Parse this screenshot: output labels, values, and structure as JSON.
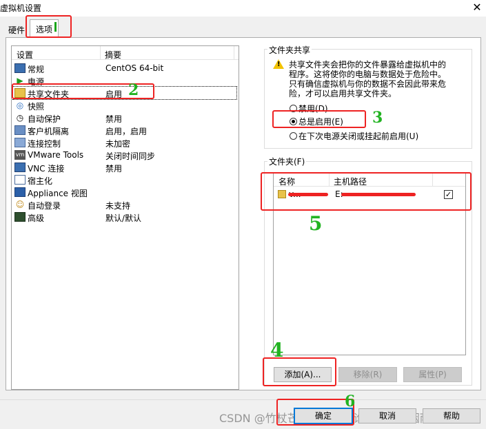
{
  "window": {
    "title": "虚拟机设置",
    "close_glyph": "✕"
  },
  "tabs": [
    {
      "label": "硬件",
      "active": false
    },
    {
      "label": "选项",
      "active": true
    }
  ],
  "settings_list": {
    "headers": {
      "setting": "设置",
      "summary": "摘要"
    },
    "rows": [
      {
        "name": "常规",
        "summary": "CentOS 64-bit",
        "icon": "monitor-icon"
      },
      {
        "name": "电源",
        "summary": "",
        "icon": "play-icon"
      },
      {
        "name": "共享文件夹",
        "summary": "启用",
        "icon": "shared-folder-icon",
        "selected": true
      },
      {
        "name": "快照",
        "summary": "",
        "icon": "snapshot-icon"
      },
      {
        "name": "自动保护",
        "summary": "禁用",
        "icon": "clock-icon"
      },
      {
        "name": "客户机隔离",
        "summary": "启用，启用",
        "icon": "isolation-icon"
      },
      {
        "name": "连接控制",
        "summary": "未加密",
        "icon": "access-control-icon"
      },
      {
        "name": "VMware Tools",
        "summary": "关闭时间同步",
        "icon": "vmware-tools-icon"
      },
      {
        "name": "VNC 连接",
        "summary": "禁用",
        "icon": "vnc-icon"
      },
      {
        "name": "宿主化",
        "summary": "",
        "icon": "unity-icon"
      },
      {
        "name": "Appliance 视图",
        "summary": "",
        "icon": "appliance-icon"
      },
      {
        "name": "自动登录",
        "summary": "未支持",
        "icon": "autologin-icon"
      },
      {
        "name": "高级",
        "summary": "默认/默认",
        "icon": "advanced-icon"
      }
    ]
  },
  "shared_folders": {
    "group_title": "文件夹共享",
    "warning_lines": [
      "共享文件夹会把你的文件暴露给虚拟机中的",
      "程序。这将使你的电脑与数据处于危险中。",
      "只有确信虚拟机与你的数据不会因此带来危",
      "险，才可以启用共享文件夹。"
    ],
    "options": [
      {
        "label": "禁用(D)",
        "checked": false
      },
      {
        "label": "总是启用(E)",
        "checked": true
      },
      {
        "label": "在下次电源关闭或挂起前启用(U)",
        "checked": false
      }
    ]
  },
  "folders": {
    "group_title": "文件夹(F)",
    "headers": {
      "name": "名称",
      "path": "主机路径"
    },
    "rows": [
      {
        "name": "v...",
        "path": "E:",
        "enabled": true
      }
    ],
    "check_glyph": "✓",
    "buttons": {
      "add": "添加(A)...",
      "remove": "移除(R)",
      "properties": "属性(P)"
    }
  },
  "footer": {
    "ok": "确定",
    "cancel": "取消",
    "help": "帮助"
  },
  "watermark": "CSDN @竹杖芒鞋轻胜马，谁怕？一蓑烟雨任平生",
  "annotations": [
    "2",
    "3",
    "5",
    "4",
    "6"
  ],
  "colors": {
    "annotation_red": "#ee2222",
    "annotation_green": "#22b322",
    "focus_blue": "#0078d7"
  }
}
